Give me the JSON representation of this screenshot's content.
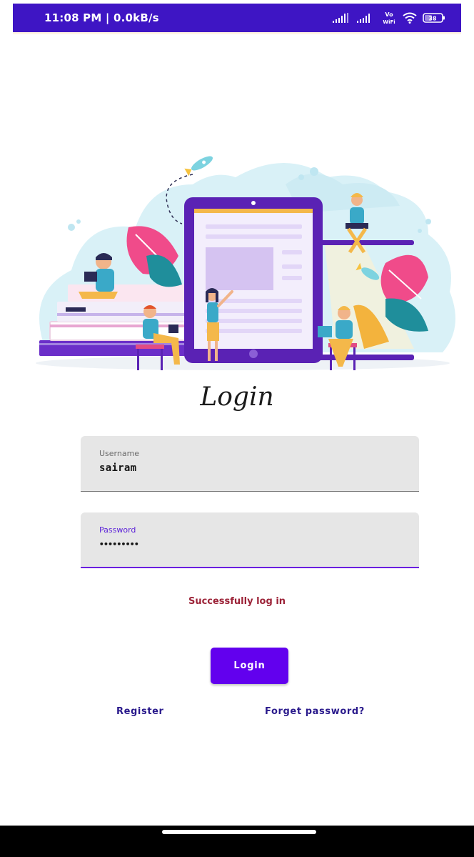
{
  "status_bar": {
    "time_speed": "11:08 PM | 0.0kB/s",
    "battery": "38",
    "vowifi_top": "Vo",
    "vowifi_bottom": "WiFi",
    "signal1_icon": "signal-icon",
    "signal2_icon": "signal-icon",
    "wifi_icon": "wifi-icon",
    "battery_icon": "battery-icon",
    "bg_color": "#3e15c4"
  },
  "illustration": {
    "icon": "people-tablet-illustration"
  },
  "title": "Login",
  "username_field": {
    "label": "Username",
    "value": "sairam"
  },
  "password_field": {
    "label": "Password",
    "value": "•••••••••"
  },
  "message": "Successfully log in",
  "login_button": "Login",
  "register_link": "Register",
  "forgot_link": "Forget password?",
  "colors": {
    "accent": "#6200ee",
    "message": "#9c2338",
    "link": "#2a1a8c"
  }
}
